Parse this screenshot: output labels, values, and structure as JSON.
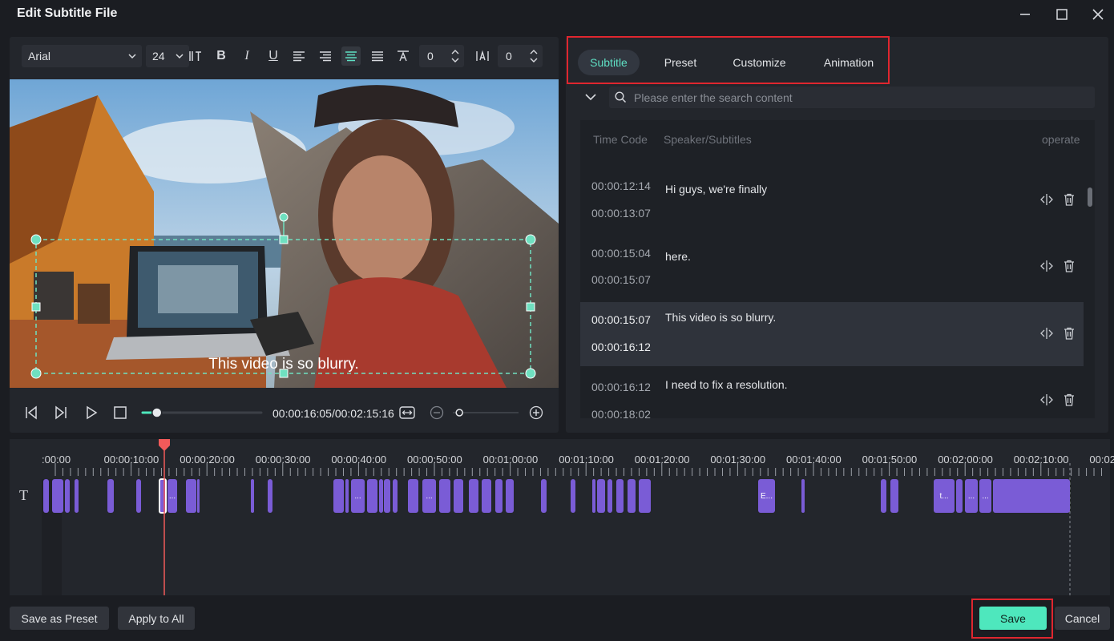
{
  "window": {
    "title": "Edit Subtitle File"
  },
  "toolbar": {
    "font": "Arial",
    "size": "24",
    "letter_spacing": "0",
    "line_spacing": "0"
  },
  "preview": {
    "caption": "This video is so blurry."
  },
  "playback": {
    "timecode": "00:00:16:05/00:02:15:16",
    "progress": 0.12,
    "zoom": 0.1
  },
  "tabs": [
    {
      "label": "Subtitle",
      "active": true
    },
    {
      "label": "Preset",
      "active": false
    },
    {
      "label": "Customize",
      "active": false
    },
    {
      "label": "Animation",
      "active": false
    }
  ],
  "search": {
    "placeholder": "Please enter the search content"
  },
  "list": {
    "headers": {
      "time": "Time Code",
      "speaker": "Speaker/Subtitles",
      "operate": "operate"
    },
    "rows": [
      {
        "start": "00:00:12:14",
        "end": "00:00:13:07",
        "text": "Hi guys, we're finally",
        "selected": false
      },
      {
        "start": "00:00:15:04",
        "end": "00:00:15:07",
        "text": "here.",
        "selected": false
      },
      {
        "start": "00:00:15:07",
        "end": "00:00:16:12",
        "text": "This video is so blurry.",
        "selected": true
      },
      {
        "start": "00:00:16:12",
        "end": "00:00:18:02",
        "text": "I need to fix a resolution.",
        "selected": false
      }
    ]
  },
  "timeline": {
    "ticks": [
      ":00:00",
      "00:00:10:00",
      "00:00:20:00",
      "00:00:30:00",
      "00:00:40:00",
      "00:00:50:00",
      "00:01:00:00",
      "00:01:10:00",
      "00:01:20:00",
      "00:01:30:00",
      "00:01:40:00",
      "00:01:50:00",
      "00:02:00:00",
      "00:02:10:00",
      "00:02"
    ],
    "track_icon": "T"
  },
  "buttons": {
    "save_preset": "Save as Preset",
    "apply_all": "Apply to All",
    "save": "Save",
    "cancel": "Cancel"
  },
  "colors": {
    "accent": "#4ee7bd",
    "clip": "#7a5cd6",
    "playhead": "#f25a5a",
    "highlight": "#e0262f"
  }
}
